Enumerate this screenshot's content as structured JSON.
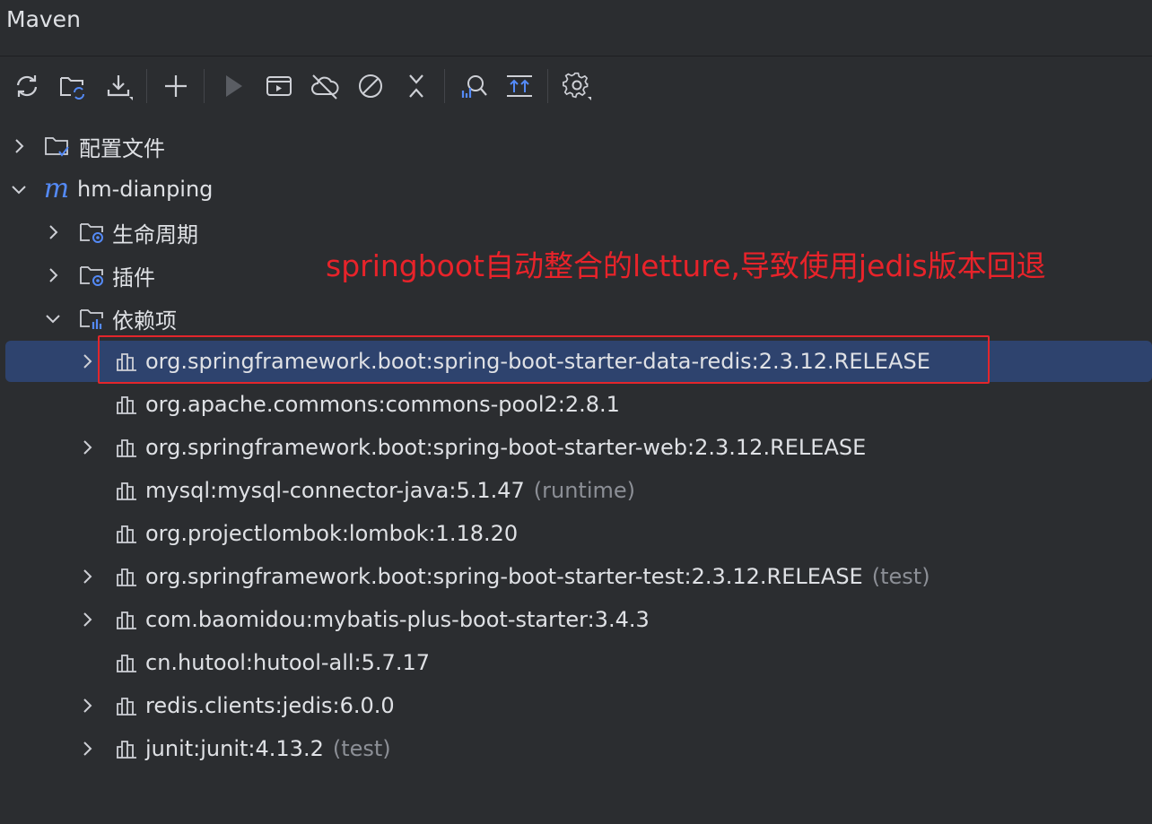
{
  "panel": {
    "title": "Maven"
  },
  "toolbar": {
    "buttons": [
      {
        "name": "reload-all-icon"
      },
      {
        "name": "reload-folder-icon"
      },
      {
        "name": "download-icon"
      },
      {
        "name": "add-icon"
      },
      {
        "name": "run-icon"
      },
      {
        "name": "execute-goal-icon"
      },
      {
        "name": "offline-icon"
      },
      {
        "name": "skip-tests-icon"
      },
      {
        "name": "collapse-all-icon"
      },
      {
        "name": "analyze-dependencies-icon"
      },
      {
        "name": "show-dependencies-icon"
      },
      {
        "name": "settings-icon"
      }
    ]
  },
  "tree": {
    "config_files": "配置文件",
    "project": "hm-dianping",
    "lifecycle": "生命周期",
    "plugins": "插件",
    "dependencies": "依赖项",
    "deps": [
      {
        "label": "org.springframework.boot:spring-boot-starter-data-redis:2.3.12.RELEASE",
        "scope": "",
        "expandable": true
      },
      {
        "label": "org.apache.commons:commons-pool2:2.8.1",
        "scope": "",
        "expandable": false
      },
      {
        "label": "org.springframework.boot:spring-boot-starter-web:2.3.12.RELEASE",
        "scope": "",
        "expandable": true
      },
      {
        "label": "mysql:mysql-connector-java:5.1.47",
        "scope": "(runtime)",
        "expandable": false
      },
      {
        "label": "org.projectlombok:lombok:1.18.20",
        "scope": "",
        "expandable": false
      },
      {
        "label": "org.springframework.boot:spring-boot-starter-test:2.3.12.RELEASE",
        "scope": "(test)",
        "expandable": true
      },
      {
        "label": "com.baomidou:mybatis-plus-boot-starter:3.4.3",
        "scope": "",
        "expandable": true
      },
      {
        "label": "cn.hutool:hutool-all:5.7.17",
        "scope": "",
        "expandable": false
      },
      {
        "label": "redis.clients:jedis:6.0.0",
        "scope": "",
        "expandable": true
      },
      {
        "label": "junit:junit:4.13.2",
        "scope": "(test)",
        "expandable": true
      }
    ]
  },
  "annotation": {
    "text": "springboot自动整合的letture,导致使用jedis版本回退",
    "color": "#e8232a"
  },
  "colors": {
    "background": "#2b2d30",
    "selection": "#2e436e",
    "text": "#dfe1e5",
    "muted": "#8c8f96",
    "accent_blue": "#548af7"
  }
}
